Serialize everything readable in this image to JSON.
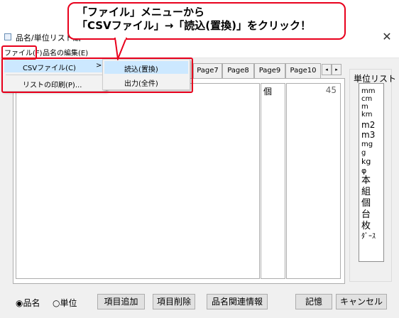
{
  "window": {
    "title": "品名/単位リスト編"
  },
  "menubar": {
    "file_label": "ファイル(F)",
    "edit_label": "品名の編集(E)"
  },
  "file_menu": {
    "csv_label": "CSVファイル(C)",
    "csv_arrow": ">",
    "print_label": "リストの印刷(P)..."
  },
  "csv_submenu": {
    "read_label": "読込(置換)",
    "output_label": "出力(全件)"
  },
  "tabs": [
    "Page7",
    "Page8",
    "Page9",
    "Page10"
  ],
  "tab_arrows": {
    "left": "◂",
    "right": "▸"
  },
  "table": {
    "unit_value": "個",
    "count_value": "45"
  },
  "unit_list": {
    "label": "単位リスト",
    "items": [
      "mm",
      "cm",
      "m",
      "km",
      "m2",
      "m3",
      "mg",
      "g",
      "kg",
      "φ",
      "本",
      "組",
      "個",
      "台",
      "枚",
      "ﾀﾞｰｽ"
    ]
  },
  "bottom": {
    "radio_item": "品名",
    "radio_unit": "単位",
    "add_button": "項目追加",
    "delete_button": "項目削除",
    "info_button": "品名関連情報",
    "save_button": "記憶",
    "cancel_button": "キャンセル"
  },
  "callout": {
    "line1": "「ファイル」メニューから",
    "line2": "「CSVファイル」→「読込(置換)」をクリック！"
  },
  "colors": {
    "highlight_red": "#e8001c",
    "menu_selected": "#cce8ff"
  }
}
